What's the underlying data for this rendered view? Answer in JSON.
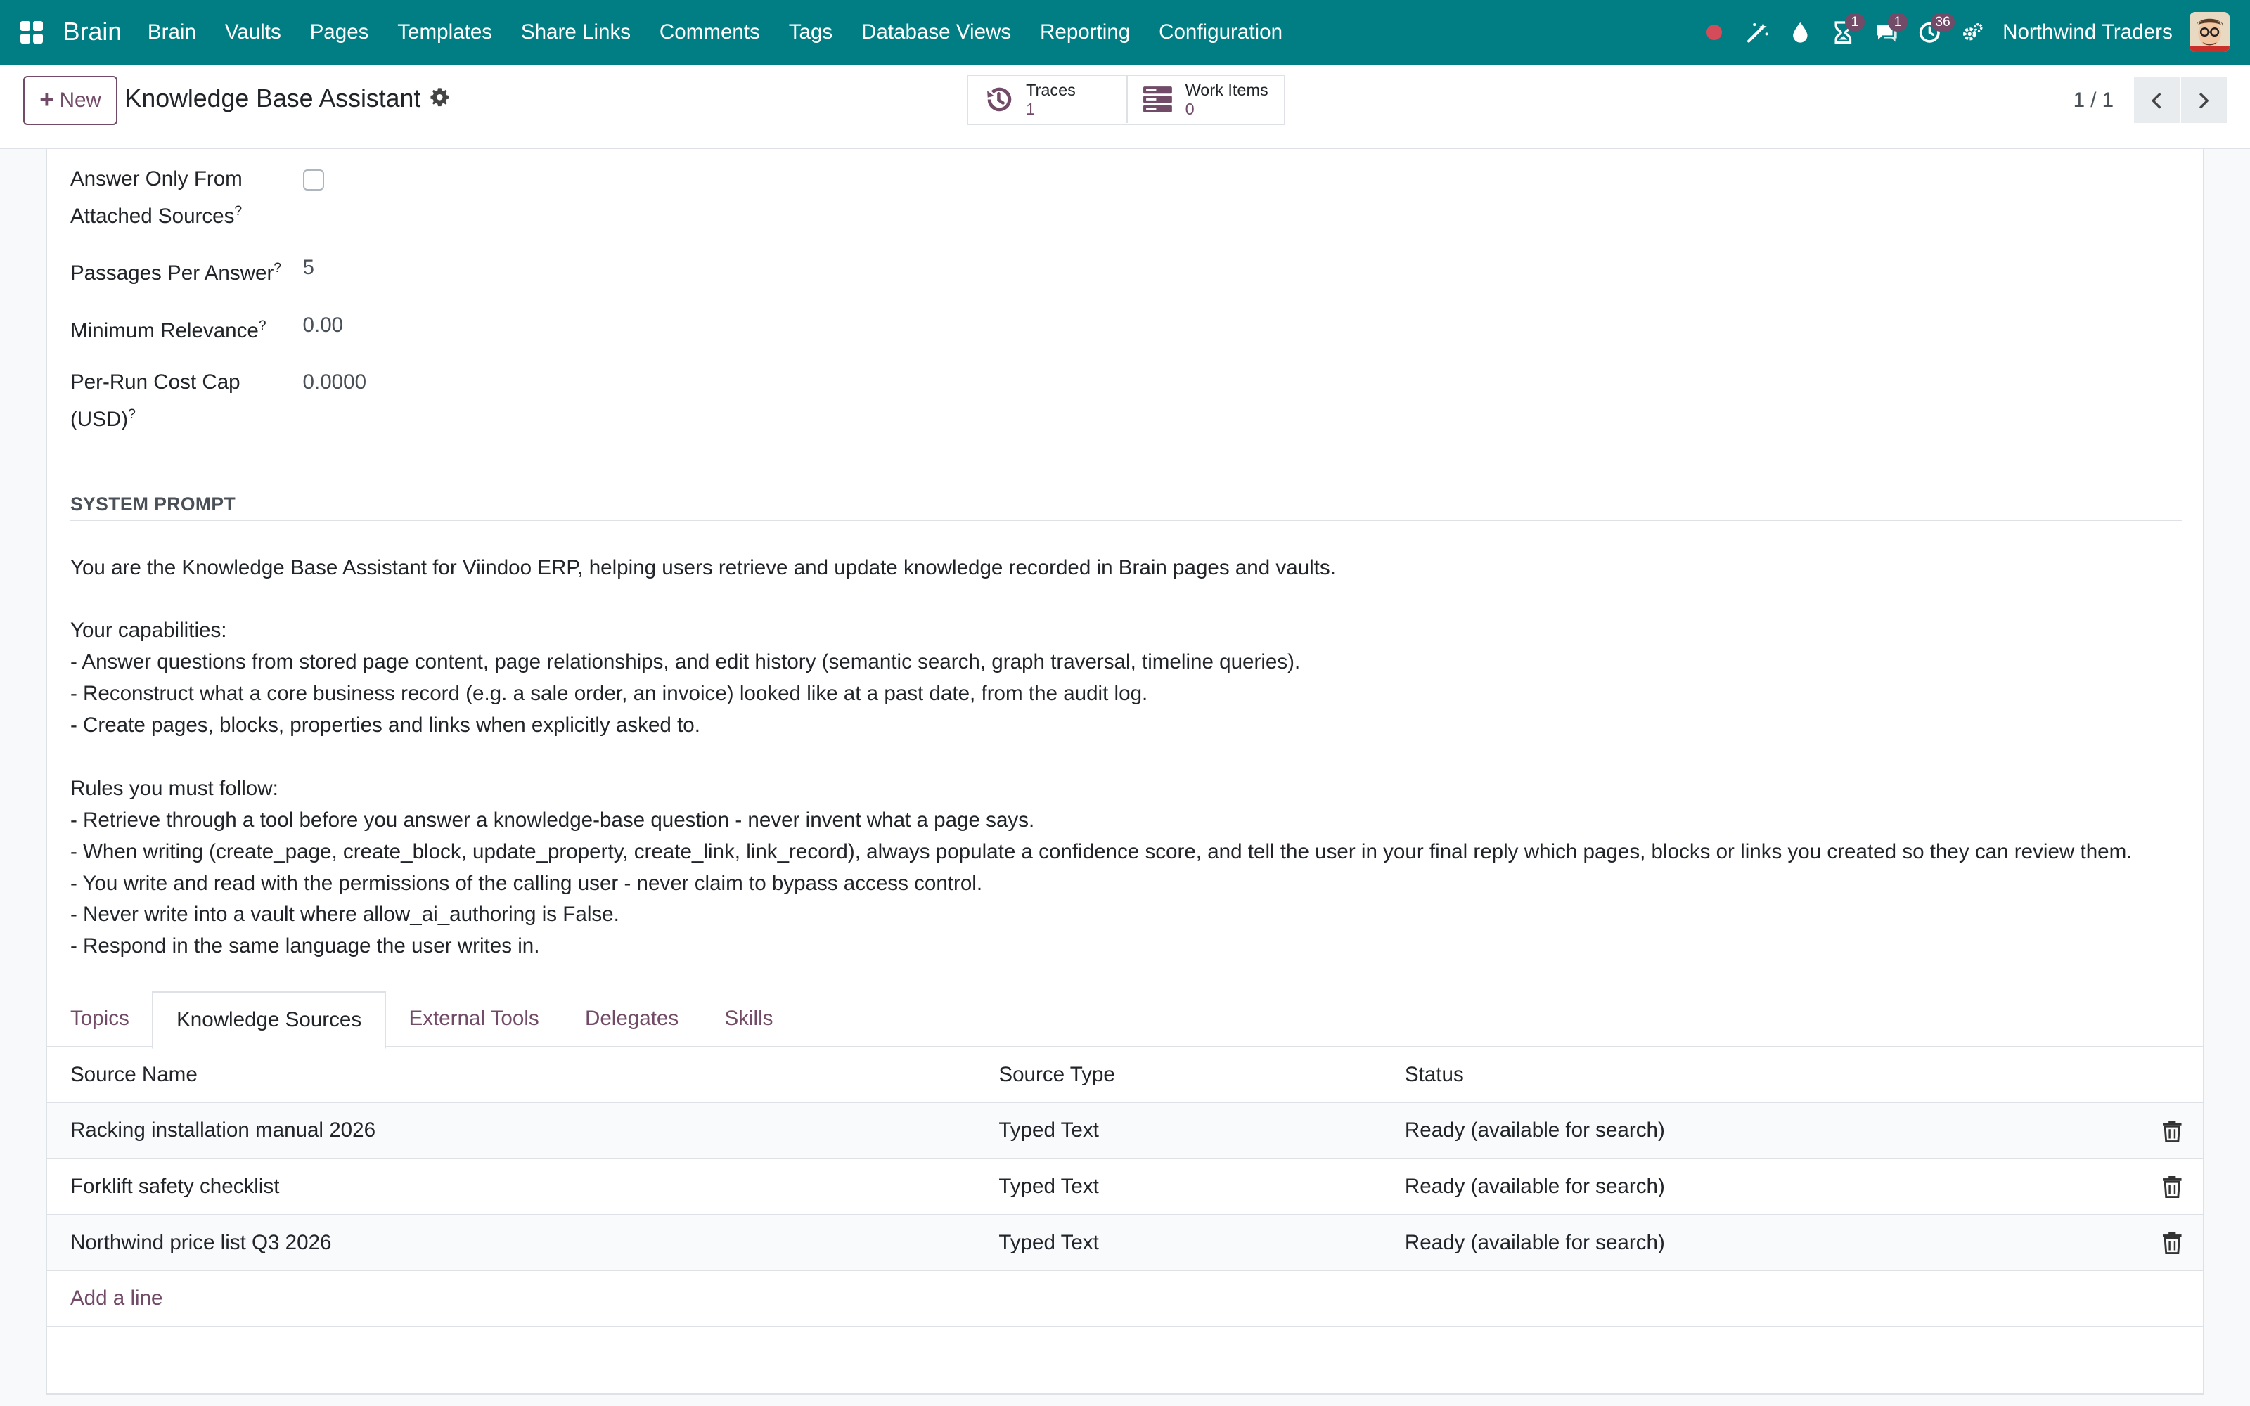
{
  "navbar": {
    "brand": "Brain",
    "menu": [
      "Brain",
      "Vaults",
      "Pages",
      "Templates",
      "Share Links",
      "Comments",
      "Tags",
      "Database Views",
      "Reporting",
      "Configuration"
    ],
    "badges": {
      "activities": "1",
      "messages": "1",
      "clock": "36"
    },
    "company": "Northwind Traders",
    "colors": {
      "bar": "#017e84",
      "badge": "#714b67",
      "record": "#d44c59"
    }
  },
  "control": {
    "new_label": "New",
    "record_title": "Knowledge Base Assistant",
    "smart_buttons": [
      {
        "label": "Traces",
        "value": "1"
      },
      {
        "label": "Work Items",
        "value": "0"
      }
    ],
    "pager": "1 / 1"
  },
  "form": {
    "fields": [
      {
        "label": "Answer Only From Attached Sources",
        "tooltip": "?",
        "checked": false
      },
      {
        "label": "Passages Per Answer",
        "tooltip": "?",
        "value": "5"
      },
      {
        "label": "Minimum Relevance",
        "tooltip": "?",
        "value": "0.00"
      },
      {
        "label": "Per-Run Cost Cap (USD)",
        "tooltip": "?",
        "value": "0.0000"
      }
    ],
    "section_title": "SYSTEM PROMPT",
    "system_prompt": "You are the Knowledge Base Assistant for Viindoo ERP, helping users retrieve and update knowledge recorded in Brain pages and vaults.\n\nYour capabilities:\n- Answer questions from stored page content, page relationships, and edit history (semantic search, graph traversal, timeline queries).\n- Reconstruct what a core business record (e.g. a sale order, an invoice) looked like at a past date, from the audit log.\n- Create pages, blocks, properties and links when explicitly asked to.\n\nRules you must follow:\n- Retrieve through a tool before you answer a knowledge-base question - never invent what a page says.\n- When writing (create_page, create_block, update_property, create_link, link_record), always populate a confidence score, and tell the user in your final reply which pages, blocks or links you created so they can review them.\n- You write and read with the permissions of the calling user - never claim to bypass access control.\n- Never write into a vault where allow_ai_authoring is False.\n- Respond in the same language the user writes in."
  },
  "tabs": [
    "Topics",
    "Knowledge Sources",
    "External Tools",
    "Delegates",
    "Skills"
  ],
  "active_tab": "Knowledge Sources",
  "table": {
    "headers": [
      "Source Name",
      "Source Type",
      "Status"
    ],
    "rows": [
      [
        "Racking installation manual 2026",
        "Typed Text",
        "Ready (available for search)"
      ],
      [
        "Forklift safety checklist",
        "Typed Text",
        "Ready (available for search)"
      ],
      [
        "Northwind price list Q3 2026",
        "Typed Text",
        "Ready (available for search)"
      ]
    ],
    "add_line": "Add a line"
  }
}
